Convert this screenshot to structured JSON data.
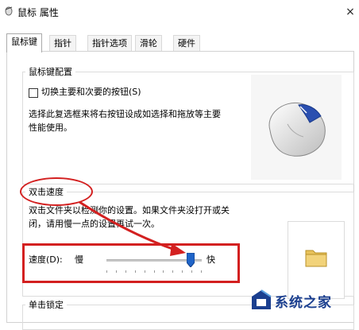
{
  "window": {
    "title": "鼠标 属性",
    "close_symbol": "×"
  },
  "tabs": [
    {
      "label": "鼠标键",
      "active": true
    },
    {
      "label": "指针",
      "active": false
    },
    {
      "label": "指针选项",
      "active": false
    },
    {
      "label": "滑轮",
      "active": false
    },
    {
      "label": "硬件",
      "active": false
    }
  ],
  "button_config": {
    "group_title": "鼠标键配置",
    "checkbox_label": "切换主要和次要的按钮(S)",
    "checkbox_checked": false,
    "description_line1": "选择此复选框来将右按钮设成如选择和拖放等主要",
    "description_line2": "性能使用。"
  },
  "double_click": {
    "group_title": "双击速度",
    "description_line1": "双击文件夹以检测你的设置。如果文件夹没打开或关",
    "description_line2": "闭，请用慢一点的设置再试一次。",
    "speed_label": "速度(D):",
    "slow_label": "慢",
    "fast_label": "快",
    "speed_fraction": 0.88
  },
  "click_lock": {
    "group_title": "单击锁定"
  },
  "annotation": {
    "color": "#d32020"
  },
  "watermark": {
    "text": "系统之家"
  },
  "icons": [
    "mouse-settings-icon",
    "close-icon",
    "mouse-image",
    "folder-icon",
    "watermark-logo-icon"
  ]
}
